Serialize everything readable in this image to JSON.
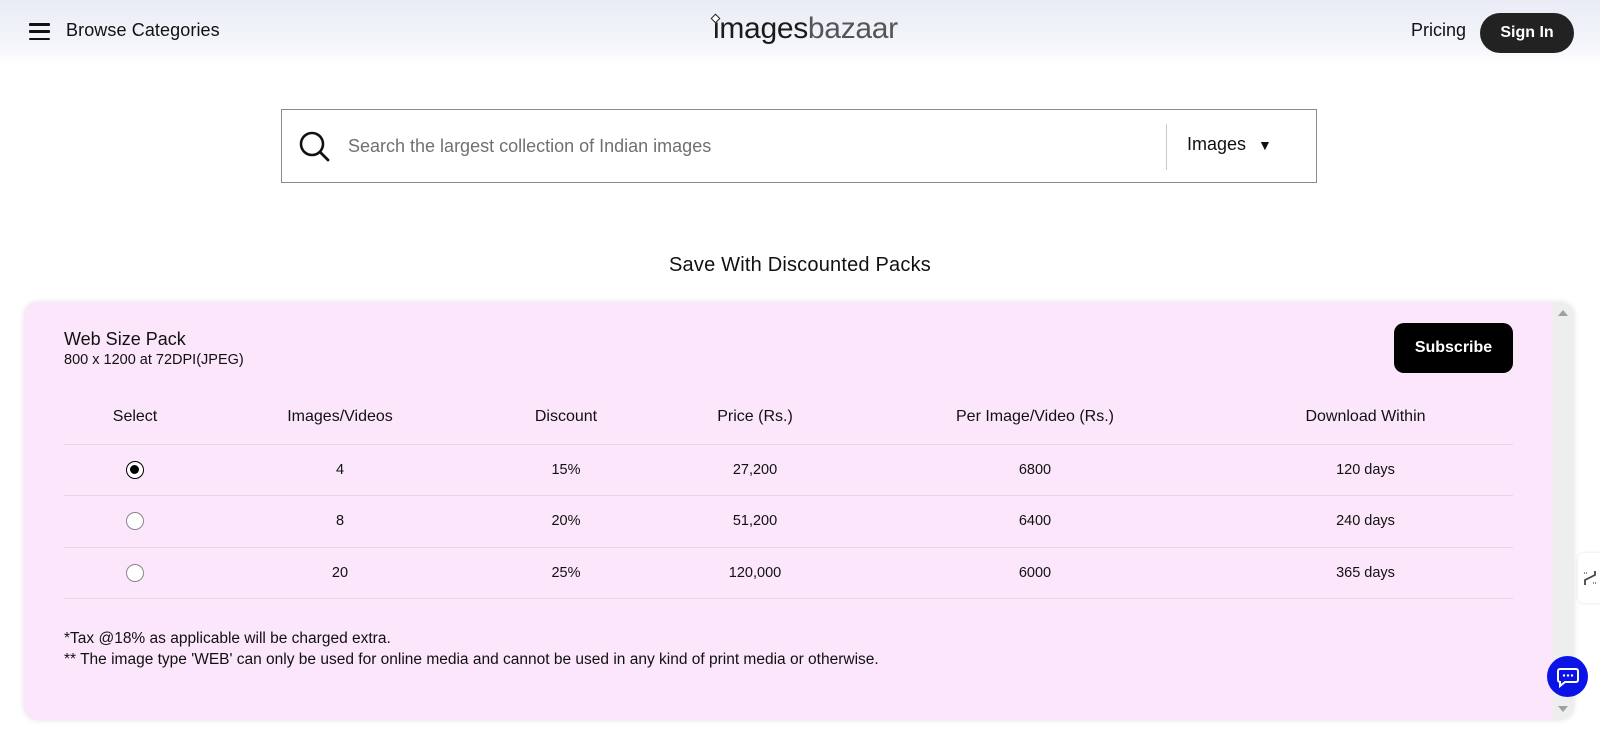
{
  "header": {
    "browse_label": "Browse Categories",
    "logo_part1": "images",
    "logo_part2": "bazaar",
    "pricing_label": "Pricing",
    "signin_label": "Sign In"
  },
  "search": {
    "placeholder": "Search the largest collection of Indian images",
    "value": "",
    "type_selected": "Images",
    "caret": "▼"
  },
  "section_title": "Save With Discounted Packs",
  "pack": {
    "title": "Web Size Pack",
    "subtitle": "800 x 1200 at 72DPI(JPEG)",
    "subscribe_label": "Subscribe",
    "columns": [
      "Select",
      "Images/Videos",
      "Discount",
      "Price (Rs.)",
      "Per Image/Video (Rs.)",
      "Download Within"
    ],
    "rows": [
      {
        "selected": true,
        "images": "4",
        "discount": "15%",
        "price": "27,200",
        "per_image": "6800",
        "download": "120 days"
      },
      {
        "selected": false,
        "images": "8",
        "discount": "20%",
        "price": "51,200",
        "per_image": "6400",
        "download": "240 days"
      },
      {
        "selected": false,
        "images": "20",
        "discount": "25%",
        "price": "120,000",
        "per_image": "6000",
        "download": "365 days"
      }
    ],
    "notes": [
      "*Tax @18% as applicable will be charged extra.",
      "** The image type 'WEB' can only be used for online media and cannot be used in any kind of print media or otherwise."
    ]
  },
  "icons": {
    "menu": "hamburger-icon",
    "search": "search-icon",
    "chat": "chat-icon",
    "side_tab": "resize-icon"
  },
  "colors": {
    "card_bg": "#fbe6fb",
    "button_dark": "#000000",
    "chat_accent": "#0a14e6"
  }
}
